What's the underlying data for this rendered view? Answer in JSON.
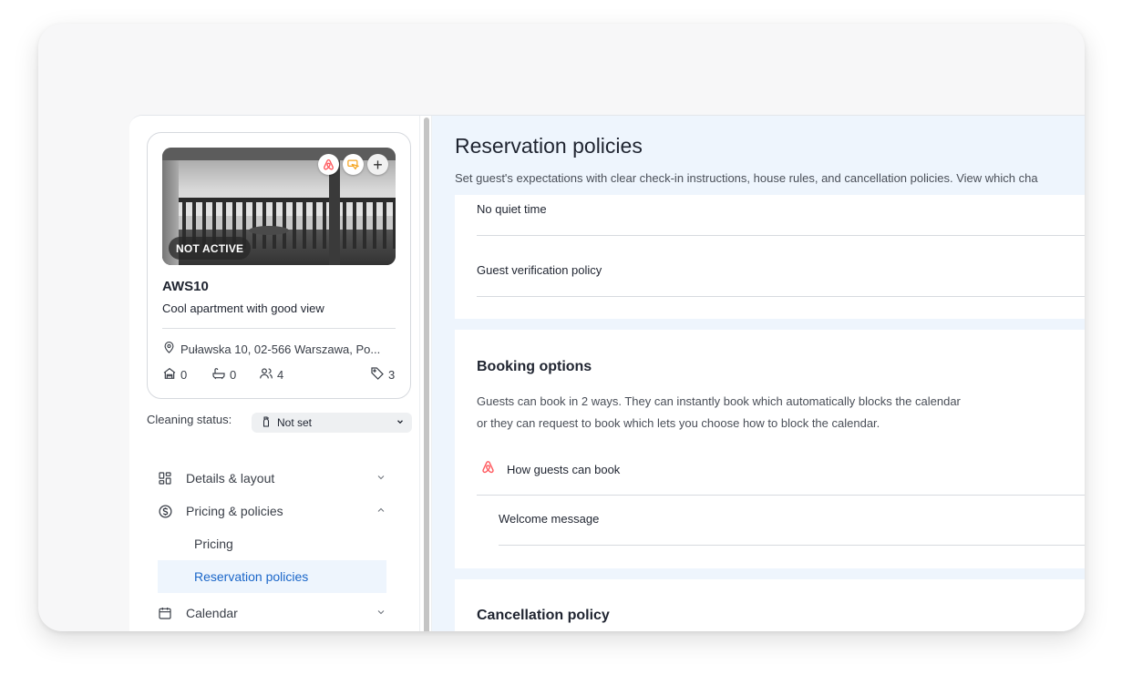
{
  "property": {
    "code": "AWS10",
    "name": "Cool apartment with good view",
    "status_badge": "NOT ACTIVE",
    "address": "Puławska 10, 02-566 Warszawa, Po...",
    "bedrooms": "0",
    "bathrooms": "0",
    "guests": "4",
    "tags": "3"
  },
  "cleaning": {
    "label": "Cleaning status:",
    "value": "Not set"
  },
  "nav": {
    "details": "Details & layout",
    "pricing_policies": "Pricing & policies",
    "pricing": "Pricing",
    "reservation_policies": "Reservation policies",
    "calendar": "Calendar"
  },
  "main": {
    "title": "Reservation policies",
    "subtitle": "Set guest's expectations with clear check-in instructions, house rules, and cancellation policies. View which cha",
    "rows": {
      "quiet_time": "No quiet time",
      "guest_verification": "Guest verification policy"
    },
    "booking": {
      "title": "Booking options",
      "desc_line1": "Guests can book in 2 ways. They can instantly book which automatically blocks the calendar",
      "desc_line2": "or they can request to book which lets you choose how to block the calendar.",
      "how_guests_book": "How guests can book",
      "welcome_message": "Welcome message"
    },
    "cancellation": {
      "title": "Cancellation policy"
    }
  },
  "colors": {
    "accent": "#1a66c9",
    "airbnb": "#ff5a5f",
    "booking_orange": "#f5a623",
    "main_bg": "#eef5fd"
  }
}
